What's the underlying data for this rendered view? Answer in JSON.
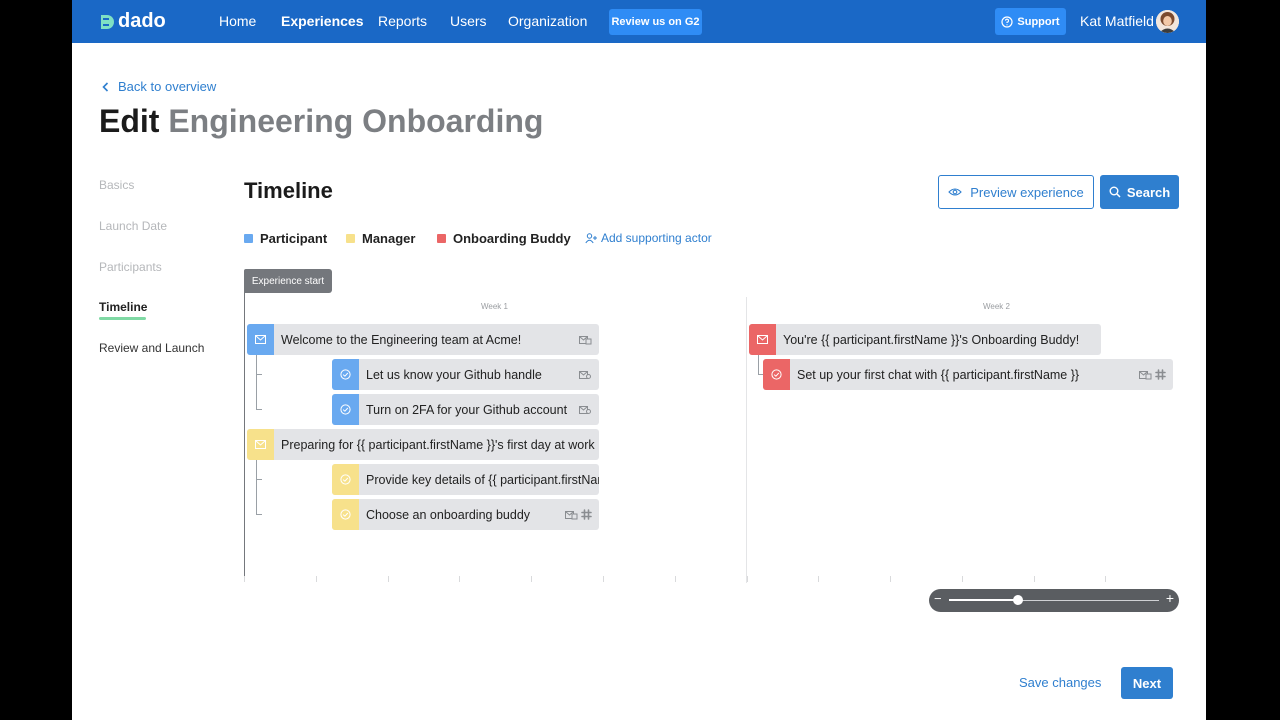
{
  "app": {
    "logo_text": "dado",
    "colors": {
      "brand": "#1a68c6",
      "accent": "#2f7fcf",
      "participant": "#69a9f0",
      "manager": "#f7e18b",
      "buddy": "#eb6666",
      "active_step": "#7fd9a4"
    }
  },
  "nav": {
    "items": [
      {
        "label": "Home"
      },
      {
        "label": "Experiences"
      },
      {
        "label": "Reports"
      },
      {
        "label": "Users"
      },
      {
        "label": "Organization"
      }
    ],
    "review_button": "Review us on G2",
    "support_button": "Support",
    "user_name": "Kat Matfield"
  },
  "header": {
    "back_link": "Back to overview",
    "title_prefix": "Edit",
    "title_name": "Engineering Onboarding"
  },
  "steps": [
    {
      "label": "Basics"
    },
    {
      "label": "Launch Date"
    },
    {
      "label": "Participants"
    },
    {
      "label": "Timeline"
    },
    {
      "label": "Review and Launch"
    }
  ],
  "timeline": {
    "title": "Timeline",
    "preview_button": "Preview experience",
    "search_button": "Search",
    "legend": [
      {
        "label": "Participant",
        "color": "#69a9f0"
      },
      {
        "label": "Manager",
        "color": "#f7e18b"
      },
      {
        "label": "Onboarding Buddy",
        "color": "#eb6666"
      }
    ],
    "add_actor": "Add supporting actor",
    "experience_start": "Experience start",
    "weeks": [
      {
        "label": "Week 1"
      },
      {
        "label": "Week 2"
      }
    ],
    "week1_items": [
      {
        "text": "Welcome to the Engineering team at Acme!",
        "icon": "mail-icon",
        "actor": "participant"
      },
      {
        "text": "Let us know your Github handle",
        "icon": "check-circle-icon",
        "actor": "participant"
      },
      {
        "text": "Turn on 2FA for your Github account",
        "icon": "check-circle-icon",
        "actor": "participant"
      },
      {
        "text": "Preparing for {{ participant.firstName }}'s first day at work",
        "icon": "mail-icon",
        "actor": "manager"
      },
      {
        "text": "Provide key details of {{ participant.firstName }}'s role",
        "icon": "check-circle-icon",
        "actor": "manager"
      },
      {
        "text": "Choose an onboarding buddy",
        "icon": "check-circle-icon",
        "actor": "manager"
      }
    ],
    "week2_items": [
      {
        "text": "You're {{ participant.firstName }}'s Onboarding Buddy!",
        "icon": "mail-icon",
        "actor": "buddy"
      },
      {
        "text": "Set up your first chat with {{ participant.firstName }}",
        "icon": "check-circle-icon",
        "actor": "buddy"
      }
    ],
    "zoom_level": 0.33
  },
  "footer": {
    "save_link": "Save changes",
    "next_button": "Next"
  }
}
